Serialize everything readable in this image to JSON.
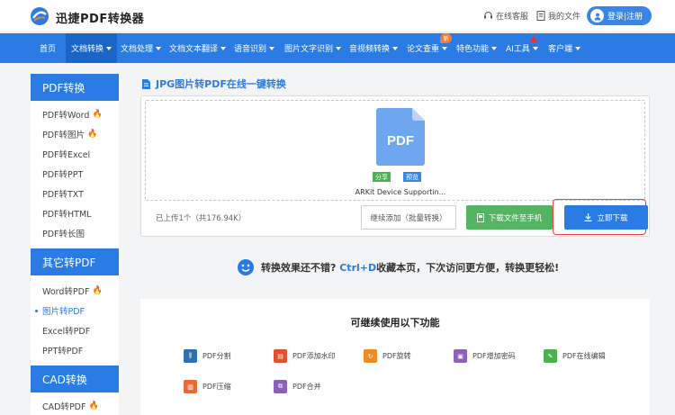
{
  "header": {
    "brand": "迅捷PDF转换器",
    "service_label": "在线客服",
    "files_label": "我的文件",
    "login_label": "登录|注册"
  },
  "nav": {
    "items": [
      {
        "label": "首页",
        "arrow": false
      },
      {
        "label": "文档转换",
        "arrow": true,
        "active": true
      },
      {
        "label": "文档处理",
        "arrow": true
      },
      {
        "label": "文档文本翻译",
        "arrow": true
      },
      {
        "label": "语音识别",
        "arrow": true
      },
      {
        "label": "图片文字识别",
        "arrow": true
      },
      {
        "label": "音视频转换",
        "arrow": true
      },
      {
        "label": "论文查重",
        "arrow": true,
        "badge": "新"
      },
      {
        "label": "特色功能",
        "arrow": true
      },
      {
        "label": "AI工具",
        "arrow": true
      },
      {
        "label": "客户端",
        "arrow": true
      }
    ]
  },
  "sidebar": {
    "sections": [
      {
        "title": "PDF转换",
        "items": [
          {
            "label": "PDF转Word",
            "hot": true
          },
          {
            "label": "PDF转图片",
            "hot": true
          },
          {
            "label": "PDF转Excel"
          },
          {
            "label": "PDF转PPT"
          },
          {
            "label": "PDF转TXT"
          },
          {
            "label": "PDF转HTML"
          },
          {
            "label": "PDF转长图"
          }
        ]
      },
      {
        "title": "其它转PDF",
        "items": [
          {
            "label": "Word转PDF",
            "hot": true
          },
          {
            "label": "图片转PDF",
            "active": true
          },
          {
            "label": "Excel转PDF"
          },
          {
            "label": "PPT转PDF"
          }
        ]
      },
      {
        "title": "CAD转换",
        "items": [
          {
            "label": "CAD转PDF",
            "hot": true
          }
        ]
      }
    ]
  },
  "main": {
    "title": "JPG图片转PDF在线一键转换",
    "file": {
      "icon_text": "PDF",
      "share_label": "分享",
      "preview_label": "预览",
      "name": "ARKit Device Supportin..."
    },
    "upload_info": "已上传1个（共176.94K）",
    "continue_label": "继续添加（批量转换）",
    "download_phone_label": "下载文件至手机",
    "download_now_label": "立即下载",
    "colors": {
      "primary": "#2b7be4",
      "green": "#55b464",
      "highlight": "#e5433b"
    }
  },
  "promo": {
    "text_a": "转换效果还不错?",
    "text_hot": "Ctrl+D",
    "text_b": "收藏本页，下次访问更方便，转换更轻松!"
  },
  "features": {
    "title": "可继续使用以下功能",
    "items": [
      {
        "label": "PDF分割",
        "color": "#2f6fb3",
        "icon": "split-icon"
      },
      {
        "label": "PDF添加水印",
        "color": "#e0502a",
        "icon": "watermark-icon"
      },
      {
        "label": "PDF旋转",
        "color": "#f08a24",
        "icon": "rotate-icon"
      },
      {
        "label": "PDF增加密码",
        "color": "#8a62b8",
        "icon": "lock-icon"
      },
      {
        "label": "PDF在线编辑",
        "color": "#4caf50",
        "icon": "edit-icon"
      },
      {
        "label": "PDF压缩",
        "color": "#e86a3a",
        "icon": "compress-icon"
      },
      {
        "label": "PDF合并",
        "color": "#8a62b8",
        "icon": "merge-icon"
      }
    ]
  }
}
